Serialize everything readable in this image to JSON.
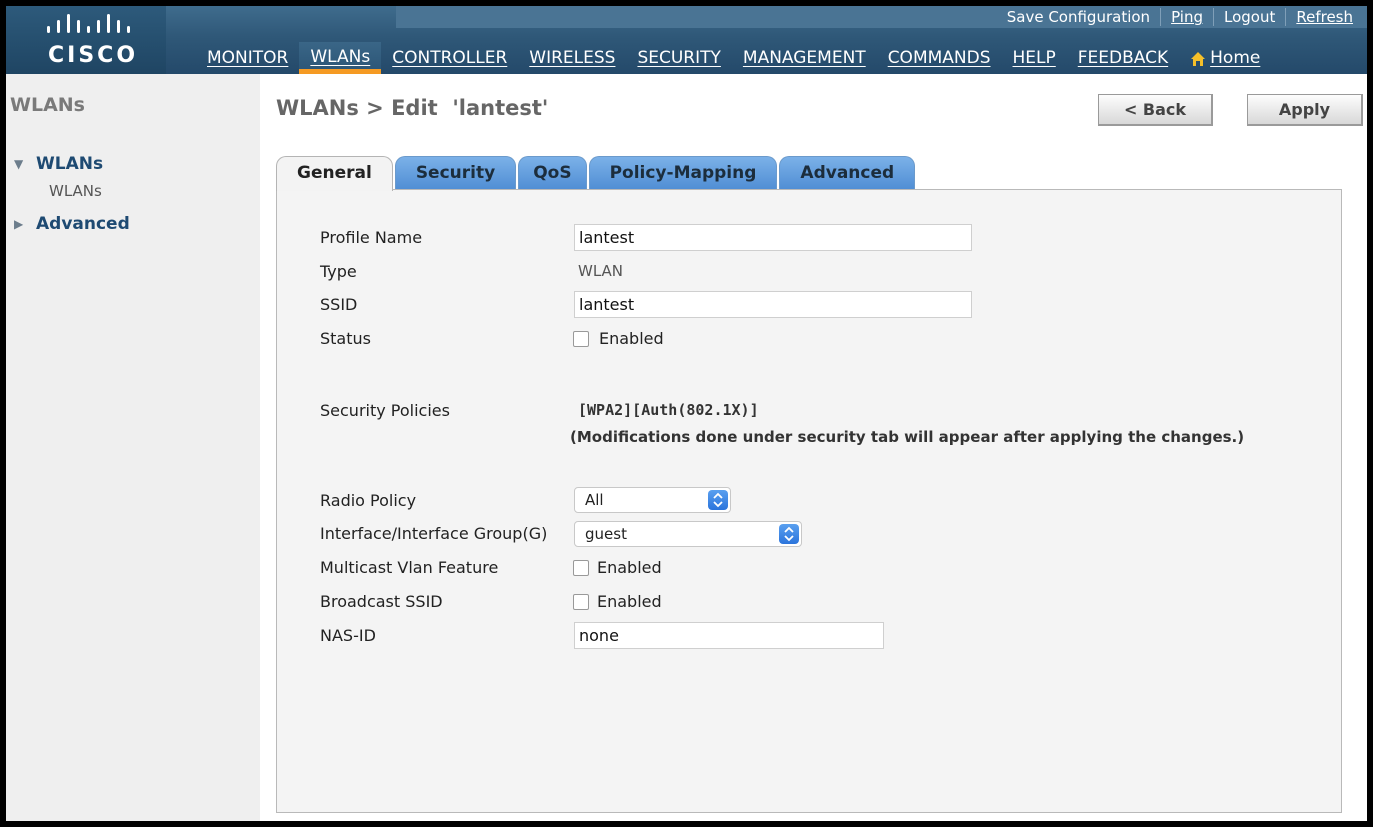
{
  "brand": {
    "logo": "cisco"
  },
  "top_links": [
    {
      "label": "Save Configuration",
      "name": "save-configuration-link"
    },
    {
      "label": "Ping",
      "name": "ping-link"
    },
    {
      "label": "Logout",
      "name": "logout-link"
    },
    {
      "label": "Refresh",
      "name": "refresh-link"
    }
  ],
  "nav": {
    "items": [
      "MONITOR",
      "WLANs",
      "CONTROLLER",
      "WIRELESS",
      "SECURITY",
      "MANAGEMENT",
      "COMMANDS",
      "HELP",
      "FEEDBACK"
    ],
    "active": "WLANs",
    "home": "Home"
  },
  "sidebar": {
    "title": "WLANs",
    "groups": [
      {
        "label": "WLANs",
        "expanded": true,
        "children": [
          "WLANs"
        ]
      },
      {
        "label": "Advanced",
        "expanded": false,
        "children": []
      }
    ]
  },
  "page": {
    "title": "WLANs > Edit  'lantest'",
    "back_label": "< Back",
    "apply_label": "Apply"
  },
  "tabs": [
    "General",
    "Security",
    "QoS",
    "Policy-Mapping",
    "Advanced"
  ],
  "active_tab": "General",
  "form": {
    "profile_name": {
      "label": "Profile Name",
      "value": "lantest"
    },
    "type": {
      "label": "Type",
      "value": "WLAN"
    },
    "ssid": {
      "label": "SSID",
      "value": "lantest"
    },
    "status": {
      "label": "Status",
      "checkbox_label": "Enabled",
      "checked": false
    },
    "security_policies": {
      "label": "Security Policies",
      "value": "[WPA2][Auth(802.1X)]",
      "note": "(Modifications done under security tab will appear after applying the changes.)"
    },
    "radio_policy": {
      "label": "Radio Policy",
      "value": "All"
    },
    "interface_group": {
      "label": "Interface/Interface Group(G)",
      "value": "guest"
    },
    "multicast_vlan": {
      "label": "Multicast Vlan Feature",
      "checkbox_label": "Enabled",
      "checked": false
    },
    "broadcast_ssid": {
      "label": "Broadcast SSID",
      "checkbox_label": "Enabled",
      "checked": false
    },
    "nas_id": {
      "label": "NAS-ID",
      "value": "none"
    }
  },
  "colors": {
    "header": "#2f5878",
    "active_nav_underline": "#f59a23",
    "tab_blue": "#5f9be0",
    "sidebar_link": "#1e4a72"
  }
}
